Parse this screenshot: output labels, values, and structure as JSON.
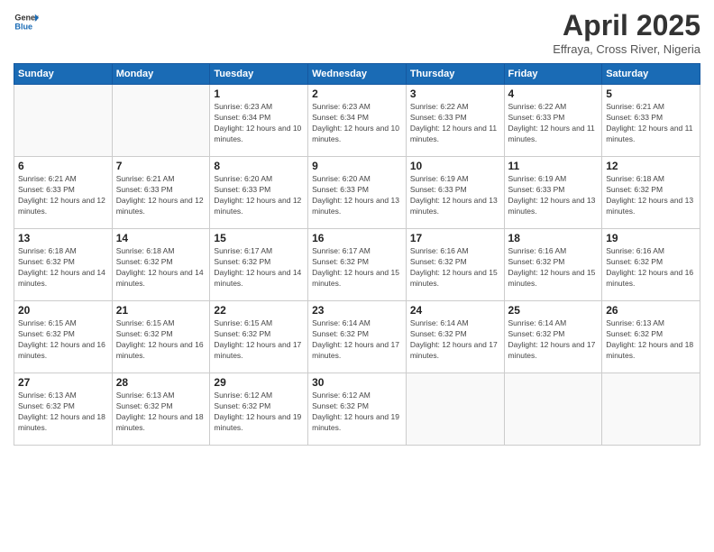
{
  "header": {
    "logo_general": "General",
    "logo_blue": "Blue",
    "month_title": "April 2025",
    "location": "Effraya, Cross River, Nigeria"
  },
  "days_of_week": [
    "Sunday",
    "Monday",
    "Tuesday",
    "Wednesday",
    "Thursday",
    "Friday",
    "Saturday"
  ],
  "weeks": [
    [
      {
        "day": "",
        "info": ""
      },
      {
        "day": "",
        "info": ""
      },
      {
        "day": "1",
        "info": "Sunrise: 6:23 AM\nSunset: 6:34 PM\nDaylight: 12 hours and 10 minutes."
      },
      {
        "day": "2",
        "info": "Sunrise: 6:23 AM\nSunset: 6:34 PM\nDaylight: 12 hours and 10 minutes."
      },
      {
        "day": "3",
        "info": "Sunrise: 6:22 AM\nSunset: 6:33 PM\nDaylight: 12 hours and 11 minutes."
      },
      {
        "day": "4",
        "info": "Sunrise: 6:22 AM\nSunset: 6:33 PM\nDaylight: 12 hours and 11 minutes."
      },
      {
        "day": "5",
        "info": "Sunrise: 6:21 AM\nSunset: 6:33 PM\nDaylight: 12 hours and 11 minutes."
      }
    ],
    [
      {
        "day": "6",
        "info": "Sunrise: 6:21 AM\nSunset: 6:33 PM\nDaylight: 12 hours and 12 minutes."
      },
      {
        "day": "7",
        "info": "Sunrise: 6:21 AM\nSunset: 6:33 PM\nDaylight: 12 hours and 12 minutes."
      },
      {
        "day": "8",
        "info": "Sunrise: 6:20 AM\nSunset: 6:33 PM\nDaylight: 12 hours and 12 minutes."
      },
      {
        "day": "9",
        "info": "Sunrise: 6:20 AM\nSunset: 6:33 PM\nDaylight: 12 hours and 13 minutes."
      },
      {
        "day": "10",
        "info": "Sunrise: 6:19 AM\nSunset: 6:33 PM\nDaylight: 12 hours and 13 minutes."
      },
      {
        "day": "11",
        "info": "Sunrise: 6:19 AM\nSunset: 6:33 PM\nDaylight: 12 hours and 13 minutes."
      },
      {
        "day": "12",
        "info": "Sunrise: 6:18 AM\nSunset: 6:32 PM\nDaylight: 12 hours and 13 minutes."
      }
    ],
    [
      {
        "day": "13",
        "info": "Sunrise: 6:18 AM\nSunset: 6:32 PM\nDaylight: 12 hours and 14 minutes."
      },
      {
        "day": "14",
        "info": "Sunrise: 6:18 AM\nSunset: 6:32 PM\nDaylight: 12 hours and 14 minutes."
      },
      {
        "day": "15",
        "info": "Sunrise: 6:17 AM\nSunset: 6:32 PM\nDaylight: 12 hours and 14 minutes."
      },
      {
        "day": "16",
        "info": "Sunrise: 6:17 AM\nSunset: 6:32 PM\nDaylight: 12 hours and 15 minutes."
      },
      {
        "day": "17",
        "info": "Sunrise: 6:16 AM\nSunset: 6:32 PM\nDaylight: 12 hours and 15 minutes."
      },
      {
        "day": "18",
        "info": "Sunrise: 6:16 AM\nSunset: 6:32 PM\nDaylight: 12 hours and 15 minutes."
      },
      {
        "day": "19",
        "info": "Sunrise: 6:16 AM\nSunset: 6:32 PM\nDaylight: 12 hours and 16 minutes."
      }
    ],
    [
      {
        "day": "20",
        "info": "Sunrise: 6:15 AM\nSunset: 6:32 PM\nDaylight: 12 hours and 16 minutes."
      },
      {
        "day": "21",
        "info": "Sunrise: 6:15 AM\nSunset: 6:32 PM\nDaylight: 12 hours and 16 minutes."
      },
      {
        "day": "22",
        "info": "Sunrise: 6:15 AM\nSunset: 6:32 PM\nDaylight: 12 hours and 17 minutes."
      },
      {
        "day": "23",
        "info": "Sunrise: 6:14 AM\nSunset: 6:32 PM\nDaylight: 12 hours and 17 minutes."
      },
      {
        "day": "24",
        "info": "Sunrise: 6:14 AM\nSunset: 6:32 PM\nDaylight: 12 hours and 17 minutes."
      },
      {
        "day": "25",
        "info": "Sunrise: 6:14 AM\nSunset: 6:32 PM\nDaylight: 12 hours and 17 minutes."
      },
      {
        "day": "26",
        "info": "Sunrise: 6:13 AM\nSunset: 6:32 PM\nDaylight: 12 hours and 18 minutes."
      }
    ],
    [
      {
        "day": "27",
        "info": "Sunrise: 6:13 AM\nSunset: 6:32 PM\nDaylight: 12 hours and 18 minutes."
      },
      {
        "day": "28",
        "info": "Sunrise: 6:13 AM\nSunset: 6:32 PM\nDaylight: 12 hours and 18 minutes."
      },
      {
        "day": "29",
        "info": "Sunrise: 6:12 AM\nSunset: 6:32 PM\nDaylight: 12 hours and 19 minutes."
      },
      {
        "day": "30",
        "info": "Sunrise: 6:12 AM\nSunset: 6:32 PM\nDaylight: 12 hours and 19 minutes."
      },
      {
        "day": "",
        "info": ""
      },
      {
        "day": "",
        "info": ""
      },
      {
        "day": "",
        "info": ""
      }
    ]
  ]
}
